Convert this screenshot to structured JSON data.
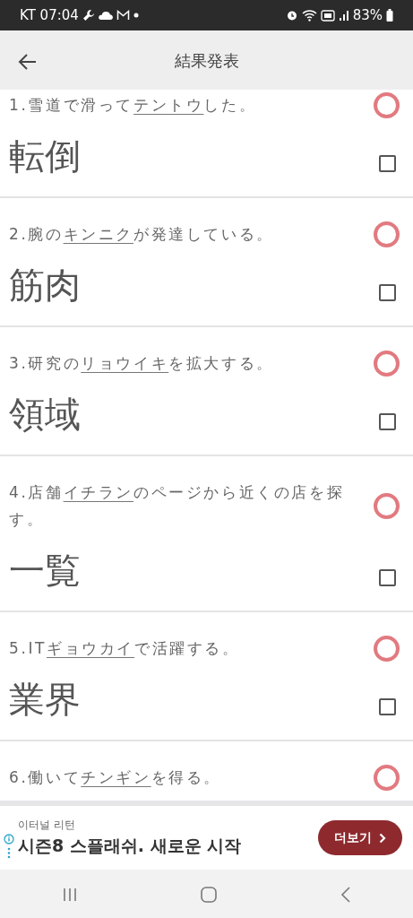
{
  "status_bar": {
    "carrier_time": "KT 07:04",
    "battery": "83%"
  },
  "app_bar": {
    "title": "結果発表"
  },
  "questions": [
    {
      "number": "1.",
      "prefix": "雪道で滑って",
      "reading": "テントウ",
      "suffix": "した。",
      "correct": true,
      "answer": "転倒",
      "checked": false
    },
    {
      "number": "2.",
      "prefix": "腕の",
      "reading": "キンニク",
      "suffix": "が発達している。",
      "correct": true,
      "answer": "筋肉",
      "checked": false
    },
    {
      "number": "3.",
      "prefix": "研究の",
      "reading": "リョウイキ",
      "suffix": "を拡大する。",
      "correct": true,
      "answer": "領域",
      "checked": false
    },
    {
      "number": "4.",
      "prefix": "店舗",
      "reading": "イチラン",
      "suffix": "のページから近くの店を探す。",
      "correct": true,
      "answer": "一覧",
      "checked": false
    },
    {
      "number": "5.",
      "prefix": "IT",
      "reading": "ギョウカイ",
      "suffix": "で活躍する。",
      "correct": true,
      "answer": "業界",
      "checked": false
    },
    {
      "number": "6.",
      "prefix": "働いて",
      "reading": "チンギン",
      "suffix": "を得る。",
      "correct": true
    }
  ],
  "ad": {
    "advertiser": "이터널 리턴",
    "headline": "시즌8 스플래쉬. 새로운 시작",
    "button": "더보기"
  }
}
